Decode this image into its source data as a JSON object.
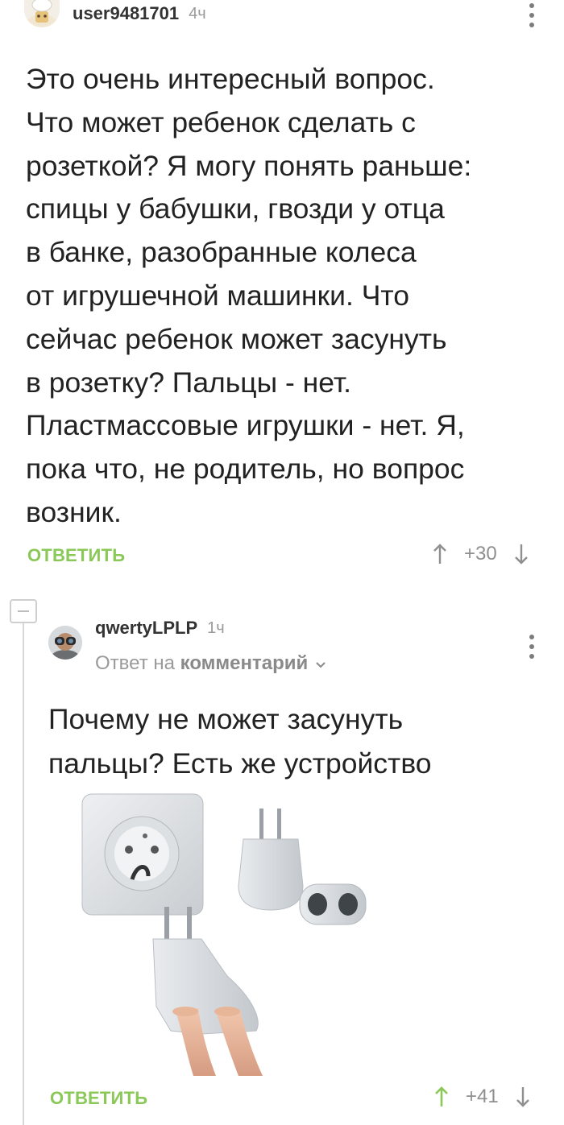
{
  "comment1": {
    "username": "user9481701",
    "time": "4ч",
    "lines": [
      "Это очень интересный вопрос.",
      "Что может ребенок сделать с",
      "розеткой? Я могу понять раньше:",
      "спицы у бабушки, гвозди у отца",
      "в банке, разобранные колеса",
      "от игрушечной машинки. Что",
      "сейчас ребенок может засунуть",
      "в розетку? Пальцы - нет.",
      "Пластмассовые игрушки - нет. Я,",
      "пока что, не родитель, но вопрос",
      "возник."
    ],
    "reply_label": "ОТВЕТИТЬ",
    "rating": "+30"
  },
  "comment2": {
    "username": "qwertyLPLP",
    "time": "1ч",
    "reply_to_prefix": "Ответ на",
    "reply_to_link": "комментарий",
    "lines": [
      "Почему не может засунуть",
      "пальцы? Есть же устройство"
    ],
    "reply_label": "ОТВЕТИТЬ",
    "rating": "+41"
  },
  "colors": {
    "accent": "#8ac858",
    "muted": "#9a9a9a",
    "text": "#222222"
  },
  "icons": [
    "avatar-chef-icon",
    "avatar-binoculars-icon",
    "kebab-menu-icon",
    "upvote-arrow-icon",
    "downvote-arrow-icon",
    "collapse-icon",
    "chevron-down-icon"
  ]
}
